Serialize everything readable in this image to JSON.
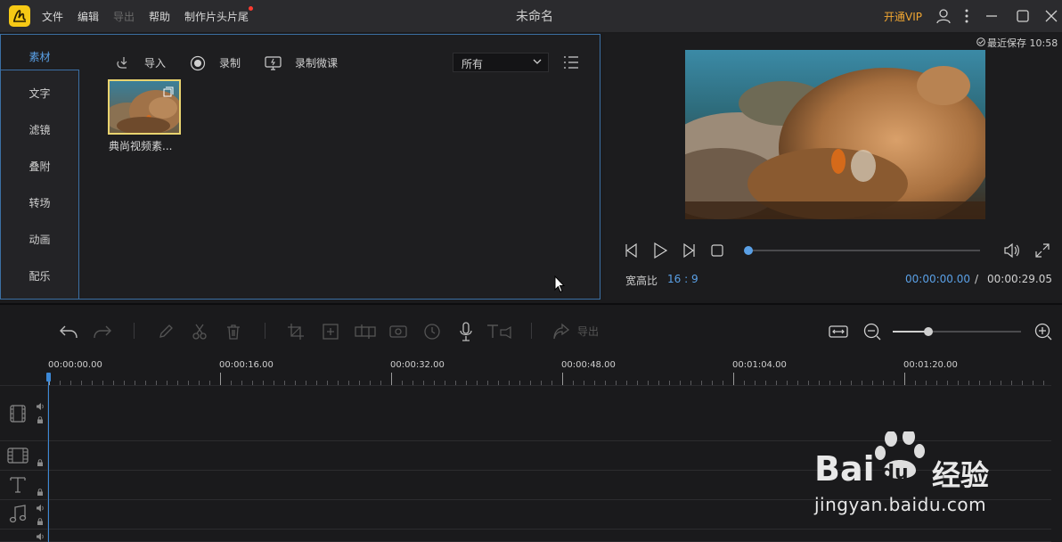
{
  "titlebar": {
    "menu": [
      "文件",
      "编辑",
      "导出",
      "帮助",
      "制作片头片尾"
    ],
    "title": "未命名",
    "vip_label": "开通VIP"
  },
  "media": {
    "tabs": [
      "素材",
      "文字",
      "滤镜",
      "叠附",
      "转场",
      "动画",
      "配乐"
    ],
    "active_tab": "素材",
    "toolbar": {
      "import_label": "导入",
      "record_label": "录制",
      "record_course_label": "录制微课"
    },
    "filter_value": "所有",
    "items": [
      {
        "name": "典尚视频素..."
      }
    ]
  },
  "preview": {
    "autosave_text": "最近保存 10:58",
    "aspect_label": "宽高比",
    "aspect_value": "16 : 9",
    "time_current": "00:00:00.00",
    "time_separator": "/",
    "time_total": "00:00:29.05",
    "progress": 0
  },
  "timeline": {
    "export_label": "导出",
    "ruler_labels": [
      "00:00:00.00",
      "00:00:16.00",
      "00:00:32.00",
      "00:00:48.00",
      "00:01:04.00",
      "00:01:20.00"
    ],
    "zoom_level": 0.28
  },
  "watermark": {
    "brand": "Bai",
    "brand_cn": "经验",
    "url": "jingyan.baidu.com"
  },
  "colors": {
    "accent": "#5aa0e6",
    "vip": "#f0a632",
    "selection_border": "#e9d36f",
    "panel_border": "#3b6fa3"
  }
}
